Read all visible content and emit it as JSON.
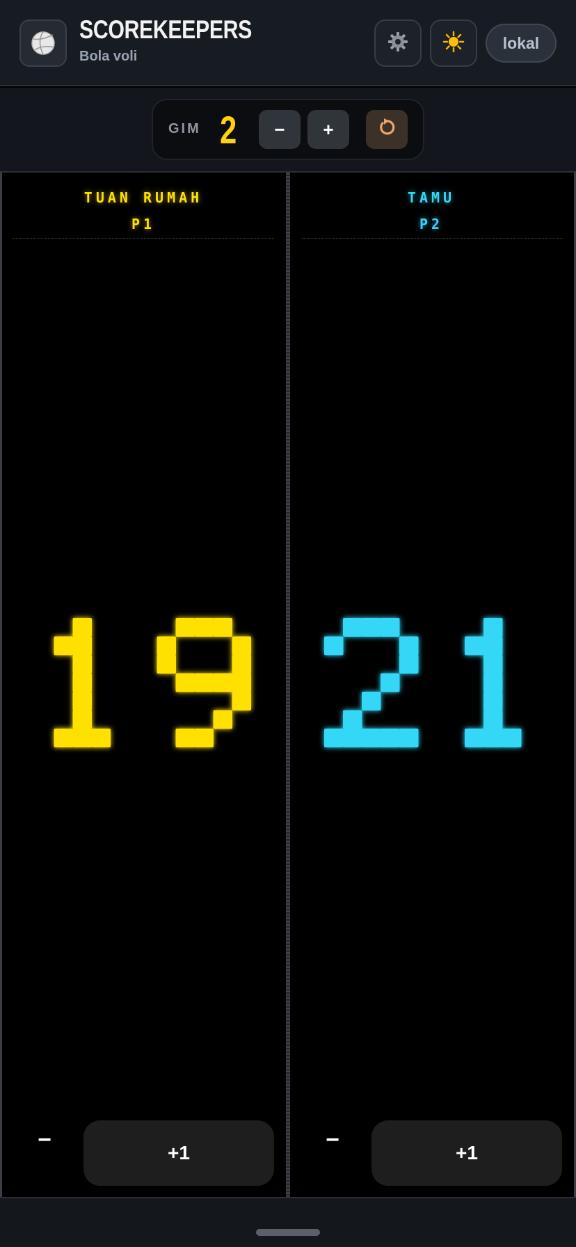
{
  "header": {
    "app_title": "SCOREKEEPERS",
    "sport": "Bola voli",
    "logo_icon": "volleyball-icon",
    "settings_icon": "gear-icon",
    "theme_icon": "sun-icon",
    "mode_label": "lokal"
  },
  "game": {
    "label": "GIM",
    "number": "2",
    "decrement_label": "−",
    "increment_label": "+",
    "reset_icon": "reset-icon"
  },
  "teams": [
    {
      "name": "TUAN RUMAH",
      "player": "P1",
      "score": "19",
      "color": "#ffe100",
      "minus_label": "−",
      "plus_label": "+1"
    },
    {
      "name": "TAMU",
      "player": "P2",
      "score": "21",
      "color": "#35d7f7",
      "minus_label": "−",
      "plus_label": "+1"
    }
  ]
}
